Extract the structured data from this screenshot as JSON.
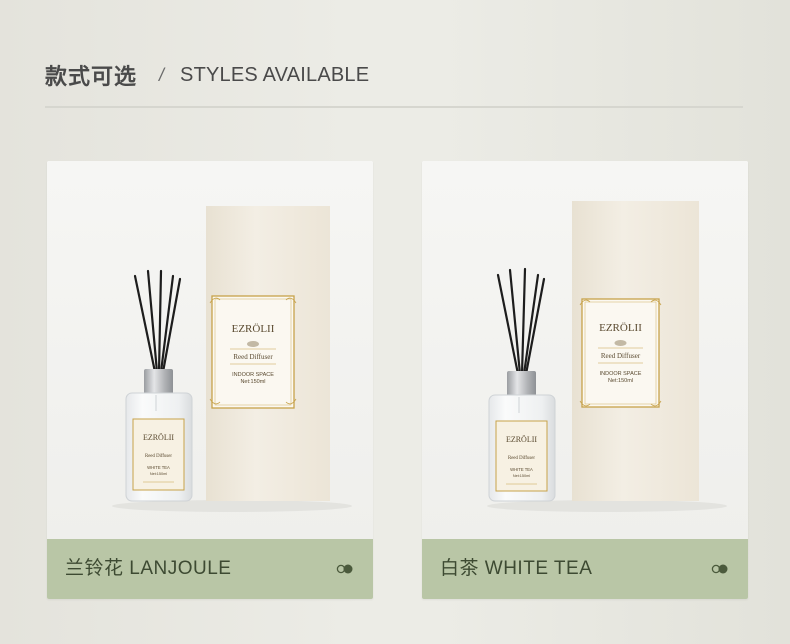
{
  "header": {
    "title_cn": "款式可选",
    "separator": "/",
    "title_en": "STYLES AVAILABLE"
  },
  "products": [
    {
      "name": "兰铃花 LANJOULE",
      "box": {
        "brand": "EZRÖLII",
        "product": "Reed Diffuser",
        "space": "INDOOR SPACE",
        "net": "Net:150ml"
      },
      "bottle": {
        "brand": "EZRÖLII",
        "product": "Reed Diffuser",
        "scent": "WHITE TEA",
        "net": "Net:150ml"
      }
    },
    {
      "name": "白茶 WHITE TEA",
      "box": {
        "brand": "EZRÖLII",
        "product": "Reed Diffuser",
        "space": "INDOOR SPACE",
        "net": "Net:150ml"
      },
      "bottle": {
        "brand": "EZRÖLII",
        "product": "Reed Diffuser",
        "scent": "WHITE TEA",
        "net": "Net:150ml"
      }
    }
  ],
  "colors": {
    "label_bar": "#b9c6a6",
    "label_text": "#3d4a32",
    "box": "#f1ebdf",
    "gold_frame": "#c7a24a",
    "cap": "#b9bbbe"
  },
  "icons": {
    "card_toggle": "toggle-icon"
  }
}
